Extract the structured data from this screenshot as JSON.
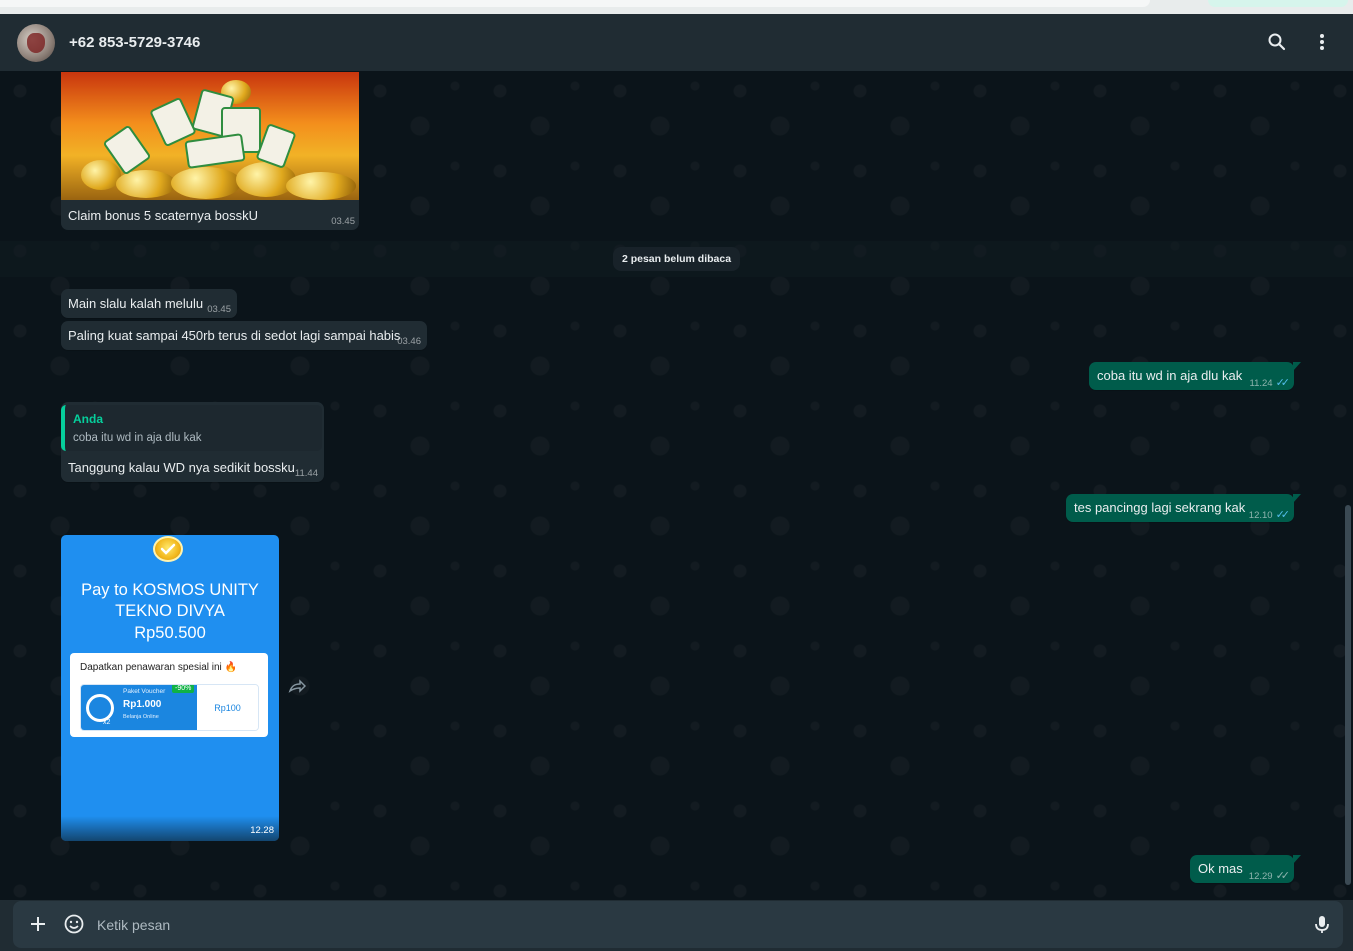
{
  "header": {
    "contact_name": "+62 853-5729-3746",
    "icons": [
      "avatar",
      "search-icon",
      "kebab-menu-icon"
    ]
  },
  "messages": {
    "image_message": {
      "caption": "Claim bonus 5 scaternya bosskU",
      "time": "03.45"
    },
    "unread_divider": "2 pesan belum dibaca",
    "in_1": {
      "text": "Main slalu kalah melulu",
      "time": "03.45"
    },
    "in_2": {
      "text": "Paling kuat sampai 450rb terus di sedot lagi sampai habis",
      "time": "03.46"
    },
    "out_1": {
      "text": "coba itu wd in aja dlu kak",
      "time": "11.24"
    },
    "reply": {
      "quoted_author": "Anda",
      "quoted_text": "coba itu wd in aja dlu kak",
      "text": "Tanggung kalau WD nya sedikit bossku",
      "time": "11.44"
    },
    "out_2": {
      "text": "tes pancingg lagi sekrang kak",
      "time": "12.10"
    },
    "payment_card": {
      "title_line1": "Pay to KOSMOS UNITY",
      "title_line2": "TEKNO DIVYA",
      "amount": "Rp50.500",
      "offer_title": "Dapatkan penawaran spesial ini 🔥",
      "voucher_label": "Paket Voucher",
      "voucher_discount": "-90%",
      "voucher_price": "Rp1.000",
      "voucher_sub": "Belanja Online",
      "voucher_qty": "x2",
      "voucher_right_price": "Rp100",
      "time": "12.28"
    },
    "out_3": {
      "text": "Ok mas",
      "time": "12.29"
    }
  },
  "composer": {
    "placeholder": "Ketik pesan"
  },
  "colors": {
    "background": "#0b141a",
    "incoming_bubble": "#202c33",
    "outgoing_bubble": "#005c4b",
    "read_ticks": "#53bdeb",
    "quote_accent": "#06cf9c"
  }
}
